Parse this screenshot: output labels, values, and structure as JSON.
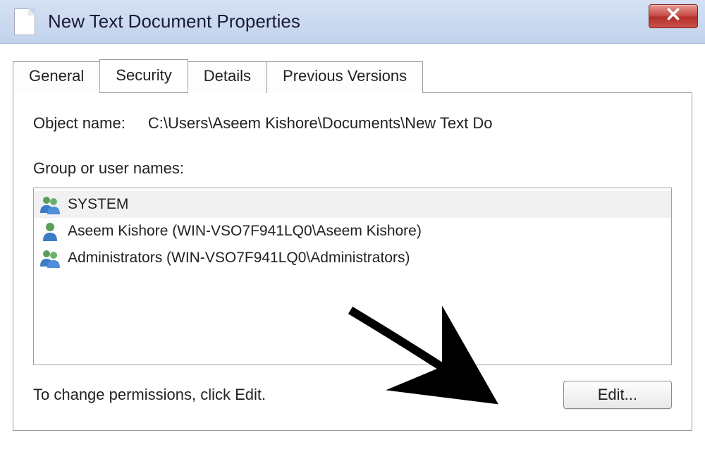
{
  "window": {
    "title": "New Text Document Properties"
  },
  "tabs": [
    {
      "label": "General"
    },
    {
      "label": "Security"
    },
    {
      "label": "Details"
    },
    {
      "label": "Previous Versions"
    }
  ],
  "security": {
    "object_name_label": "Object name:",
    "object_path": "C:\\Users\\Aseem Kishore\\Documents\\New Text Do",
    "group_label": "Group or user names:",
    "users": [
      {
        "name": "SYSTEM",
        "type": "group",
        "selected": true
      },
      {
        "name": "Aseem Kishore (WIN-VSO7F941LQ0\\Aseem Kishore)",
        "type": "user",
        "selected": false
      },
      {
        "name": "Administrators (WIN-VSO7F941LQ0\\Administrators)",
        "type": "group",
        "selected": false
      }
    ],
    "permission_text": "To change permissions, click Edit.",
    "edit_button": "Edit..."
  }
}
